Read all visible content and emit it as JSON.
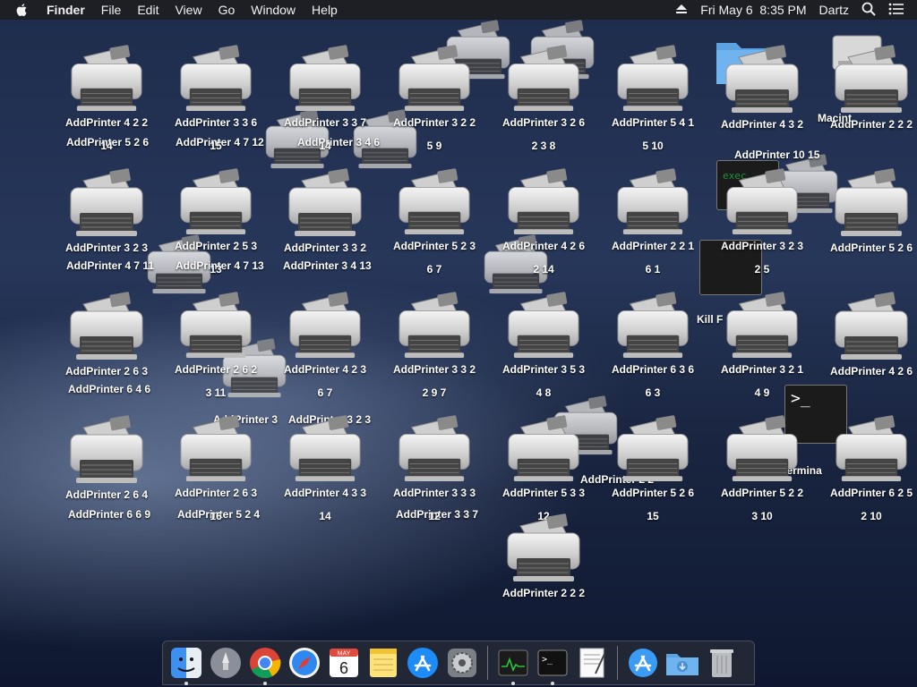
{
  "menubar": {
    "app_name": "Finder",
    "menus": [
      "File",
      "Edit",
      "View",
      "Go",
      "Window",
      "Help"
    ],
    "datetime": "Fri May 6  8:35 PM",
    "user": "Dartz",
    "icons": [
      "apple-icon",
      "eject-icon",
      "search-icon",
      "list-icon"
    ]
  },
  "desktop": {
    "icon_type": "printer-icon",
    "rows": [
      [
        "AddPrinter 4 2 2",
        "AddPrinter 3 3 6",
        "AddPrinter 3 3 7",
        "AddPrinter 3 2 2",
        "AddPrinter 3 2 6",
        "AddPrinter 5 4 1",
        "AddPrinter 4 3 2",
        "AddPrinter 2 2 2"
      ],
      [
        "AddPrinter 3 2 3",
        "AddPrinter 2 5 3",
        "AddPrinter 3 3 2",
        "AddPrinter 5 2 3",
        "AddPrinter 4 2 6",
        "AddPrinter 2 2 1",
        "AddPrinter 3 2 3",
        "AddPrinter 5 2 6"
      ],
      [
        "AddPrinter 2 6 3",
        "AddPrinter 2 6 2",
        "AddPrinter 4 2 3",
        "AddPrinter 3 3 2",
        "AddPrinter 3 5 3",
        "AddPrinter 6 3 6",
        "AddPrinter 3 2 1",
        "AddPrinter 4 2 6"
      ],
      [
        "AddPrinter 2 6 4",
        "AddPrinter 2 6 3",
        "AddPrinter 4 3 3",
        "AddPrinter 3 3 3",
        "AddPrinter 5 3 3",
        "AddPrinter 5 2 6",
        "AddPrinter 5 2 2",
        "AddPrinter 6 2 5"
      ]
    ],
    "sublabels": [
      [
        "14",
        "15",
        "14",
        "5 9",
        "2 3 8",
        "5 10",
        "",
        ""
      ],
      [
        "",
        "13",
        "",
        "6 7",
        "2 14",
        "6 1",
        "2 5",
        ""
      ],
      [
        "",
        "3 11",
        "6 7",
        "2 9 7",
        "4 8",
        "6 3",
        "4 9",
        ""
      ],
      [
        "",
        "16",
        "14",
        "12",
        "12",
        "15",
        "3 10",
        "2 10"
      ]
    ],
    "extra_label": "AddPrinter 2 2 2",
    "scattered_labels": [
      "AddPrinter 5 2 6",
      "AddPrinter 4 7 12",
      "AddPrinter 3 4 6",
      "AddPrinter 4 7 11",
      "AddPrinter 4 7 13",
      "AddPrinter 3 4 13",
      "AddPrinter 6 4 6",
      "AddPrinter 3",
      "AddPrinter 3 2 3",
      "AddPrinter 6 6 9",
      "AddPrinter 5 2 4",
      "AddPrinter 3 3 7",
      "Kill F",
      "Macint",
      "Termina",
      "AddPrinter 2 2",
      "AddPrinter 10 15"
    ]
  },
  "dock": {
    "items": [
      "finder-icon",
      "launchpad-icon",
      "chrome-icon",
      "safari-icon",
      "calendar-icon",
      "notes-icon",
      "app-store-icon",
      "system-preferences-icon",
      "activity-monitor-icon",
      "terminal-icon",
      "textedit-icon",
      "app-store-folder-icon",
      "downloads-folder-icon",
      "trash-icon"
    ],
    "calendar_month": "MAY",
    "calendar_day": "6",
    "terminal_prompt": ">_"
  }
}
